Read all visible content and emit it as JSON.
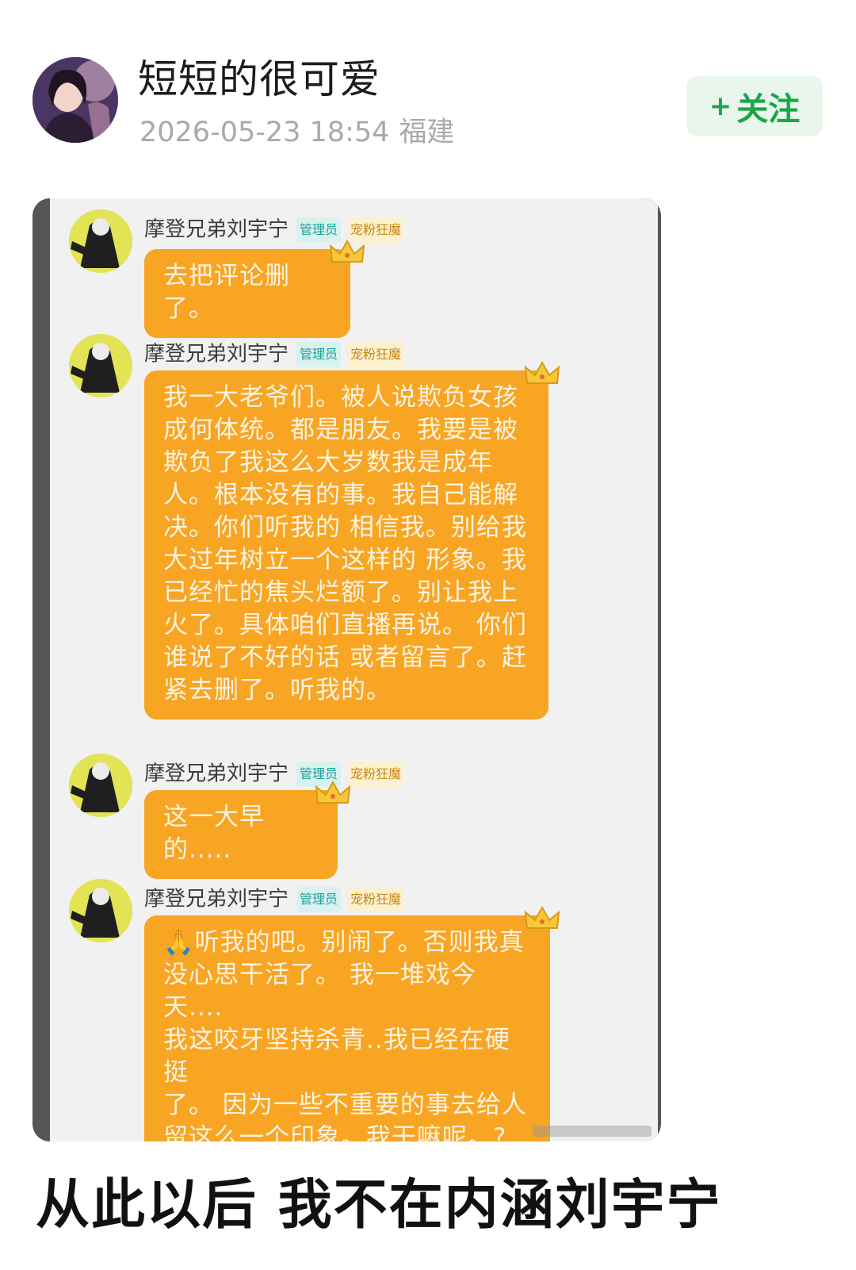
{
  "post": {
    "username": "短短的很可爱",
    "timestamp": "2026-05-23 18:54",
    "location": "福建",
    "follow_icon": "plus-icon",
    "follow_label": "关注",
    "avatar_icon": "user-avatar",
    "caption": "从此以后 我不在内涵刘宇宁"
  },
  "screenshot": {
    "messages": [
      {
        "sender": "摩登兄弟刘宇宁",
        "badge_admin": "管理员",
        "badge_fan": "宠粉狂魔",
        "text": "去把评论删了。"
      },
      {
        "sender": "摩登兄弟刘宇宁",
        "badge_admin": "管理员",
        "badge_fan": "宠粉狂魔",
        "text": "我一大老爷们。被人说欺负女孩\n成何体统。都是朋友。我要是被\n欺负了我这么大岁数我是成年\n人。根本没有的事。我自己能解\n决。你们听我的 相信我。别给我\n大过年树立一个这样的 形象。我\n已经忙的焦头烂额了。别让我上\n火了。具体咱们直播再说。 你们\n谁说了不好的话 或者留言了。赶\n紧去删了。听我的。"
      },
      {
        "sender": "摩登兄弟刘宇宁",
        "badge_admin": "管理员",
        "badge_fan": "宠粉狂魔",
        "text": "这一大早的....."
      },
      {
        "sender": "摩登兄弟刘宇宁",
        "badge_admin": "管理员",
        "badge_fan": "宠粉狂魔",
        "text": "🙏听我的吧。别闹了。否则我真\n没心思干活了。 我一堆戏今天....\n我这咬牙坚持杀青..我已经在硬挺\n了。 因为一些不重要的事去给人\n留这么一个印象。我干嘛呢。?\n你们听我的.拴Q了。"
      }
    ]
  },
  "colors": {
    "follow_green": "#1aa64a",
    "follow_bg": "#e9f6ec",
    "bubble_orange": "#f8a523",
    "meta_gray": "#a9a9a9"
  }
}
